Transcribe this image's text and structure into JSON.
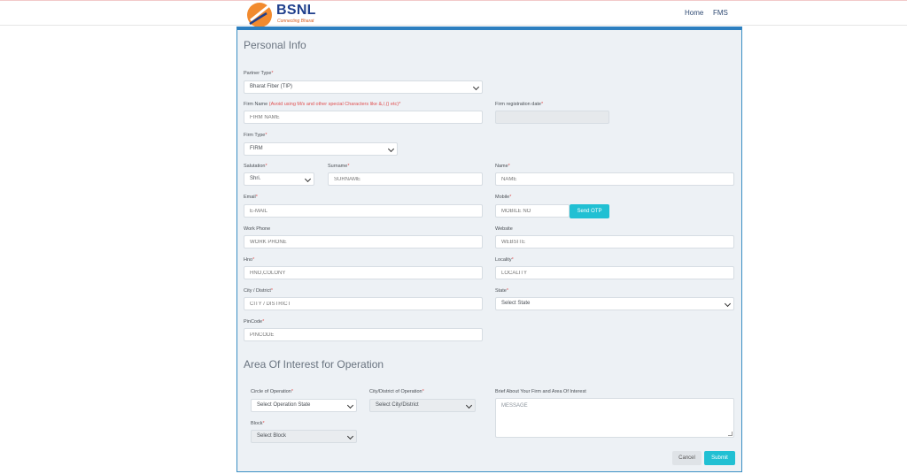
{
  "header": {
    "brand": "BSNL",
    "tagline": "Connecting Bharat",
    "nav": [
      "Home",
      "FMS"
    ]
  },
  "form": {
    "section_personal": "Personal Info",
    "partner_type": {
      "label": "Partner Type",
      "value": "Bharat Fiber (TIP)"
    },
    "firm_name": {
      "label": "Firm Name",
      "note": "(Avoid using M/s and other special Characters like &,/,() etc)",
      "placeholder": "FIRM NAME"
    },
    "firm_reg_date": {
      "label": "Firm registration date"
    },
    "firm_type": {
      "label": "Firm Type",
      "value": "FIRM"
    },
    "salutation": {
      "label": "Salutation",
      "value": "Shri."
    },
    "surname": {
      "label": "Surname",
      "placeholder": "SURNAME"
    },
    "name": {
      "label": "Name",
      "placeholder": "NAME"
    },
    "email": {
      "label": "Email",
      "placeholder": "E-MAIL"
    },
    "mobile": {
      "label": "Mobile",
      "placeholder": "MOBILE NO",
      "otp_button": "Send OTP"
    },
    "work_phone": {
      "label": "Work Phone",
      "placeholder": "WORK PHONE"
    },
    "website": {
      "label": "Website",
      "placeholder": "WEBSITE"
    },
    "hno": {
      "label": "Hno",
      "placeholder": "HNO,COLONY"
    },
    "locality": {
      "label": "Locality",
      "placeholder": "LOCALITY"
    },
    "city": {
      "label": "City / District",
      "placeholder": "CITY / DISTRICT"
    },
    "state": {
      "label": "State",
      "value": "Select State"
    },
    "pincode": {
      "label": "PinCode",
      "placeholder": "PINCODE"
    },
    "section_area": "Area Of Interest for Operation",
    "circle": {
      "label": "Circle of Operation",
      "value": "Select Operation State"
    },
    "city_op": {
      "label": "City/District of Operation",
      "value": "Select City/District"
    },
    "brief": {
      "label": "Brief About Your Firm and Area Of Interest",
      "placeholder": "MESSAGE"
    },
    "block": {
      "label": "Block",
      "value": "Select Block"
    },
    "cancel": "Cancel",
    "submit": "Submit"
  },
  "colors": {
    "accent": "#21c0d3",
    "panel_border": "#2d7fc0",
    "required": "#e05050"
  }
}
